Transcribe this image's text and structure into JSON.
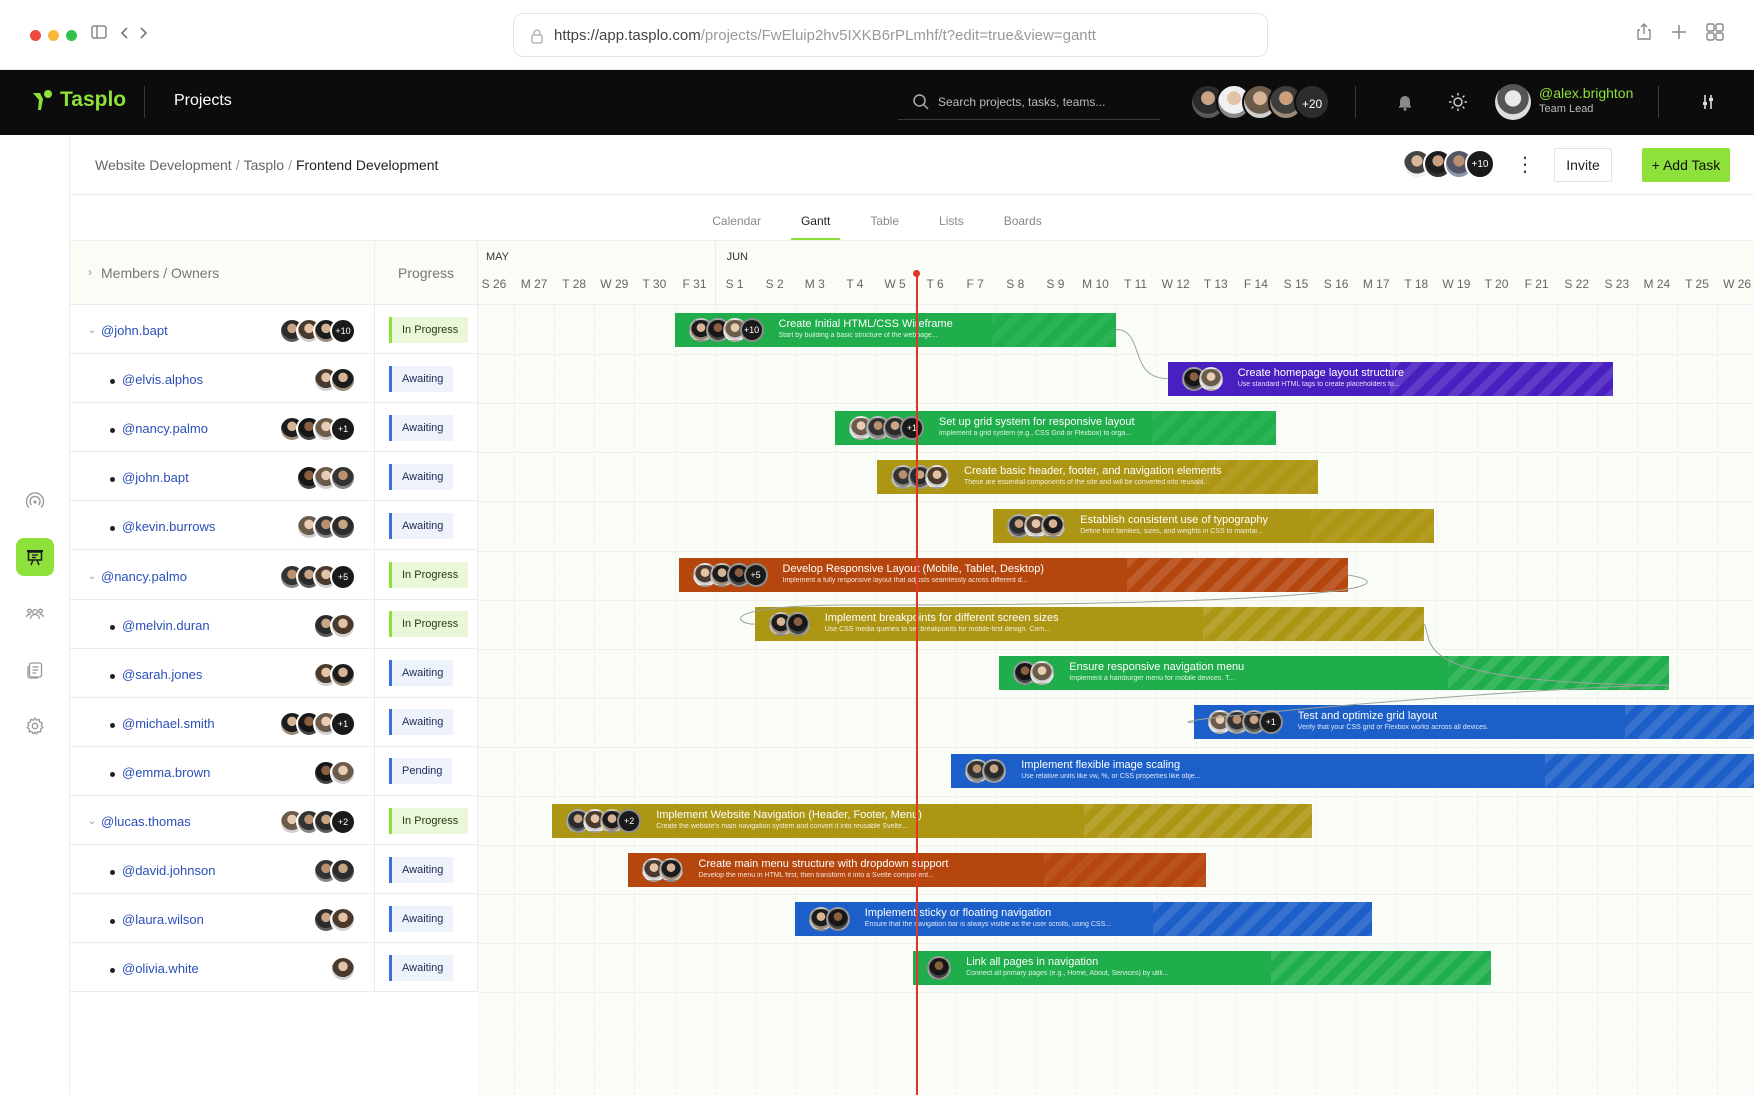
{
  "browser": {
    "url_host": "https://app.tasplo.com",
    "url_path": "/projects/FwEluip2hv5IXKB6rPLmhf/t?edit=true&view=gantt"
  },
  "topnav": {
    "brand": "Tasplo",
    "section": "Projects",
    "search_placeholder": "Search projects, tasks, teams...",
    "team_more": "+20",
    "user_name": "@alex.brighton",
    "user_role": "Team Lead"
  },
  "header": {
    "breadcrumb": [
      "Website Development",
      "Tasplo",
      "Frontend Development"
    ],
    "members_more": "+10",
    "invite_label": "Invite",
    "add_task_label": "+ Add Task"
  },
  "tabs": [
    "Calendar",
    "Gantt",
    "Table",
    "Lists",
    "Boards"
  ],
  "active_tab": "Gantt",
  "columns": {
    "members": "Members / Owners",
    "progress": "Progress"
  },
  "months": [
    {
      "label": "MAY",
      "day_index": 0
    },
    {
      "label": "JUN",
      "day_index": 6
    }
  ],
  "days": [
    "S 26",
    "M 27",
    "T 28",
    "W 29",
    "T 30",
    "F 31",
    "S 1",
    "S 2",
    "M 3",
    "T 4",
    "W 5",
    "T 6",
    "F 7",
    "S 8",
    "S 9",
    "M 10",
    "T 11",
    "W 12",
    "T 13",
    "F 14",
    "S 15",
    "S 16",
    "M 17",
    "T 18",
    "W 19",
    "T 20",
    "F 21",
    "S 22",
    "S 23",
    "M 24",
    "T 25",
    "W 26"
  ],
  "today_day_index": 10.5,
  "rows": [
    {
      "name": "@john.bapt",
      "level": 0,
      "status": "In Progress",
      "status_kind": "inprog",
      "avatars": 3,
      "more": "+10"
    },
    {
      "name": "@elvis.alphos",
      "level": 1,
      "status": "Awaiting",
      "status_kind": "await",
      "avatars": 2,
      "more": ""
    },
    {
      "name": "@nancy.palmo",
      "level": 1,
      "status": "Awaiting",
      "status_kind": "await",
      "avatars": 3,
      "more": "+1"
    },
    {
      "name": "@john.bapt",
      "level": 1,
      "status": "Awaiting",
      "status_kind": "await",
      "avatars": 3,
      "more": ""
    },
    {
      "name": "@kevin.burrows",
      "level": 1,
      "status": "Awaiting",
      "status_kind": "await",
      "avatars": 3,
      "more": ""
    },
    {
      "name": "@nancy.palmo",
      "level": 0,
      "status": "In Progress",
      "status_kind": "inprog",
      "avatars": 3,
      "more": "+5"
    },
    {
      "name": "@melvin.duran",
      "level": 1,
      "status": "In Progress",
      "status_kind": "inprog",
      "avatars": 2,
      "more": ""
    },
    {
      "name": "@sarah.jones",
      "level": 1,
      "status": "Awaiting",
      "status_kind": "await",
      "avatars": 2,
      "more": ""
    },
    {
      "name": "@michael.smith",
      "level": 1,
      "status": "Awaiting",
      "status_kind": "await",
      "avatars": 3,
      "more": "+1"
    },
    {
      "name": "@emma.brown",
      "level": 1,
      "status": "Pending",
      "status_kind": "pend",
      "avatars": 2,
      "more": ""
    },
    {
      "name": "@lucas.thomas",
      "level": 0,
      "status": "In Progress",
      "status_kind": "inprog",
      "avatars": 3,
      "more": "+2"
    },
    {
      "name": "@david.johnson",
      "level": 1,
      "status": "Awaiting",
      "status_kind": "await",
      "avatars": 2,
      "more": ""
    },
    {
      "name": "@laura.wilson",
      "level": 1,
      "status": "Awaiting",
      "status_kind": "await",
      "avatars": 2,
      "more": ""
    },
    {
      "name": "@olivia.white",
      "level": 1,
      "status": "Awaiting",
      "status_kind": "await",
      "avatars": 1,
      "more": ""
    }
  ],
  "tasks": [
    {
      "row": 0,
      "start": 5.0,
      "end": 16.0,
      "color": "#1fae4b",
      "done": 1.0,
      "avatars": 3,
      "more": "+10",
      "title": "Create Initial HTML/CSS Wireframe",
      "desc": "Start by building a basic structure of the webpage..."
    },
    {
      "row": 1,
      "start": 17.3,
      "end": 28.4,
      "color": "#4a1fc0",
      "done": 0.5,
      "avatars": 2,
      "more": "",
      "title": "Create homepage layout structure",
      "desc": "Use standard HTML tags to create placeholders fo..."
    },
    {
      "row": 2,
      "start": 9.0,
      "end": 20.0,
      "color": "#1fae4b",
      "done": 1.0,
      "avatars": 3,
      "more": "+1",
      "title": "Set up grid system for responsive layout",
      "desc": "Implement a grid system (e.g., CSS Grid or Flexbox) to orga..."
    },
    {
      "row": 3,
      "start": 10.05,
      "end": 21.05,
      "color": "#ad9614",
      "done": 1.0,
      "avatars": 3,
      "more": "",
      "title": "Create basic header, footer, and navigation elements",
      "desc": "These are essential components of the site and will be converted into reusabl..."
    },
    {
      "row": 4,
      "start": 12.95,
      "end": 23.95,
      "color": "#ad9614",
      "done": 1.0,
      "avatars": 3,
      "more": "",
      "title": "Establish consistent use of typography",
      "desc": "Define font families, sizes, and weights in CSS to maintai..."
    },
    {
      "row": 5,
      "start": 5.1,
      "end": 21.8,
      "color": "#b5470e",
      "done": 0.67,
      "avatars": 3,
      "more": "+5",
      "title": "Develop Responsive Layout (Mobile, Tablet, Desktop)",
      "desc": "Implement a fully responsive layout that adjusts seamlessly across different d..."
    },
    {
      "row": 6,
      "start": 7.0,
      "end": 23.7,
      "color": "#ad9614",
      "done": 0.67,
      "avatars": 2,
      "more": "",
      "title": "Implement breakpoints for different screen sizes",
      "desc": "Use CSS media queries to set breakpoints for mobile-first design. Com..."
    },
    {
      "row": 7,
      "start": 13.1,
      "end": 29.8,
      "color": "#1fae4b",
      "done": 0.67,
      "avatars": 2,
      "more": "",
      "title": "Ensure responsive navigation menu",
      "desc": "Implement a hamburger menu for mobile devices. T..."
    },
    {
      "row": 8,
      "start": 17.95,
      "end": 34.0,
      "color": "#1c5fc8",
      "done": 0.67,
      "avatars": 3,
      "more": "+1",
      "title": "Test and optimize grid layout",
      "desc": "Verify that your CSS grid or Flexbox works across all devices."
    },
    {
      "row": 9,
      "start": 11.9,
      "end": 34.0,
      "color": "#1c5fc8",
      "done": 0.67,
      "avatars": 2,
      "more": "",
      "title": "Implement flexible image scaling",
      "desc": "Use relative units like vw, %, or CSS properties like obje..."
    },
    {
      "row": 10,
      "start": 1.95,
      "end": 20.9,
      "color": "#ad9614",
      "done": 0.7,
      "avatars": 3,
      "more": "+2",
      "title": "Implement Website Navigation (Header, Footer, Menu)",
      "desc": "Create the website's main navigation system and convert it into reusable Svelte..."
    },
    {
      "row": 11,
      "start": 3.85,
      "end": 18.25,
      "color": "#b5470e",
      "done": 1.0,
      "avatars": 2,
      "more": "",
      "title": "Create main menu structure with dropdown support",
      "desc": "Develop the menu in HTML first, then transform it into a Svelte component..."
    },
    {
      "row": 12,
      "start": 8.0,
      "end": 22.4,
      "color": "#1c5fc8",
      "done": 0.62,
      "avatars": 2,
      "more": "",
      "title": "Implement sticky or floating navigation",
      "desc": "Ensure that the navigation bar is always visible as the user scrolls, using CSS..."
    },
    {
      "row": 13,
      "start": 10.95,
      "end": 25.35,
      "color": "#1fae4b",
      "done": 0.62,
      "avatars": 1,
      "more": "",
      "title": "Link all pages in navigation",
      "desc": "Connect all primary pages (e.g., Home, About, Services) by utili..."
    }
  ]
}
